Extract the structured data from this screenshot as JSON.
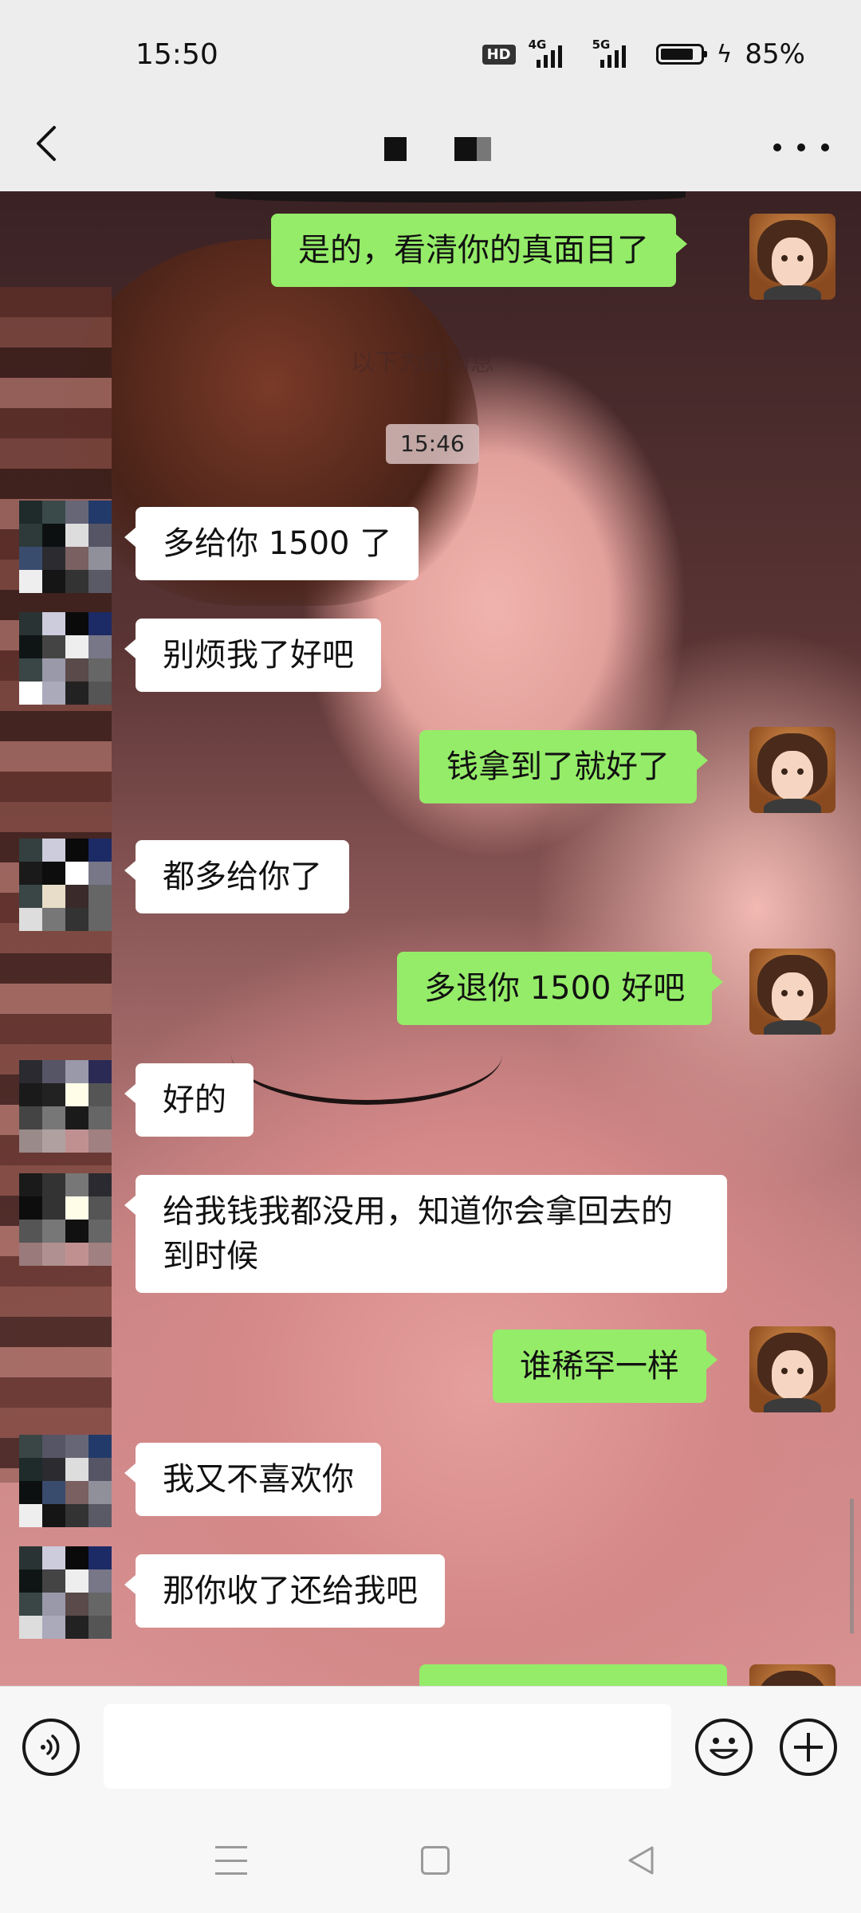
{
  "status_bar": {
    "time": "15:50",
    "hd_label": "HD",
    "network_1": "4G",
    "network_2": "5G",
    "battery_percent": "85%"
  },
  "header": {
    "back_icon": "chevron-left-icon",
    "title": "",
    "more_icon": "more-dots-icon"
  },
  "chat": {
    "new_messages_divider": "以下为新消息",
    "time_marker": "15:46",
    "messages": [
      {
        "side": "out",
        "text": "是的，看清你的真面目了"
      },
      {
        "side": "in",
        "text": "多给你 1500 了"
      },
      {
        "side": "in",
        "text": "别烦我了好吧"
      },
      {
        "side": "out",
        "text": "钱拿到了就好了"
      },
      {
        "side": "in",
        "text": "都多给你了"
      },
      {
        "side": "out",
        "text": "多退你 1500 好吧"
      },
      {
        "side": "in",
        "text": "好的"
      },
      {
        "side": "in",
        "text": "给我钱我都没用，知道你会拿回去的到时候"
      },
      {
        "side": "out",
        "text": "谁稀罕一样"
      },
      {
        "side": "in",
        "text": "我又不喜欢你"
      },
      {
        "side": "in",
        "text": "那你收了还给我吧"
      },
      {
        "side": "out",
        "text": ""
      }
    ]
  },
  "input_bar": {
    "voice_icon": "voice-icon",
    "message_value": "",
    "emoji_icon": "smiley-icon",
    "plus_icon": "plus-icon"
  },
  "nav_bar": {
    "menu_icon": "menu-icon",
    "home_icon": "home-square-icon",
    "back_icon": "back-triangle-icon"
  },
  "colors": {
    "outgoing_bubble": "#95ec69",
    "incoming_bubble": "#ffffff",
    "bar_background": "#ededed"
  }
}
